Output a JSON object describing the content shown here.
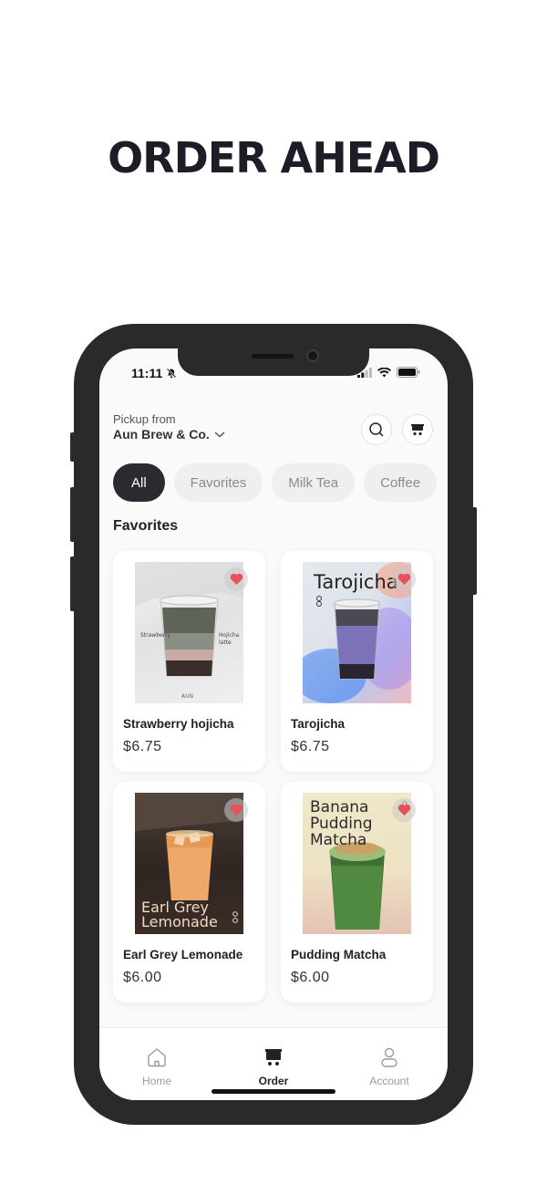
{
  "headline": "ORDER AHEAD",
  "status_bar": {
    "time": "11:11"
  },
  "header": {
    "pickup_label": "Pickup from",
    "store_name": "Aun Brew & Co."
  },
  "categories": [
    {
      "label": "All",
      "active": true
    },
    {
      "label": "Favorites",
      "active": false
    },
    {
      "label": "Milk Tea",
      "active": false
    },
    {
      "label": "Coffee",
      "active": false
    }
  ],
  "section_title": "Favorites",
  "products": [
    {
      "name": "Strawberry hojicha",
      "price": "$6.75",
      "favorited": true,
      "image_text": {
        "left": "Strawberry",
        "right_1": "Hojicha",
        "right_2": "latte",
        "brand": "AUN"
      }
    },
    {
      "name": "Tarojicha",
      "price": "$6.75",
      "favorited": true,
      "image_text": {
        "title": "Tarojicha"
      }
    },
    {
      "name": "Earl Grey Lemonade",
      "price": "$6.00",
      "favorited": true,
      "image_text": {
        "line1": "Earl Grey",
        "line2": "Lemonade"
      }
    },
    {
      "name": "Pudding Matcha",
      "price": "$6.00",
      "favorited": true,
      "image_text": {
        "line1": "Banana",
        "line2": "Pudding",
        "line3": "Matcha"
      }
    }
  ],
  "tabbar": {
    "home": "Home",
    "order": "Order",
    "account": "Account",
    "active": "order"
  },
  "colors": {
    "accent_dark": "#2a2b31",
    "heart": "#e8505b",
    "phone_frame": "#2a2a2c"
  }
}
